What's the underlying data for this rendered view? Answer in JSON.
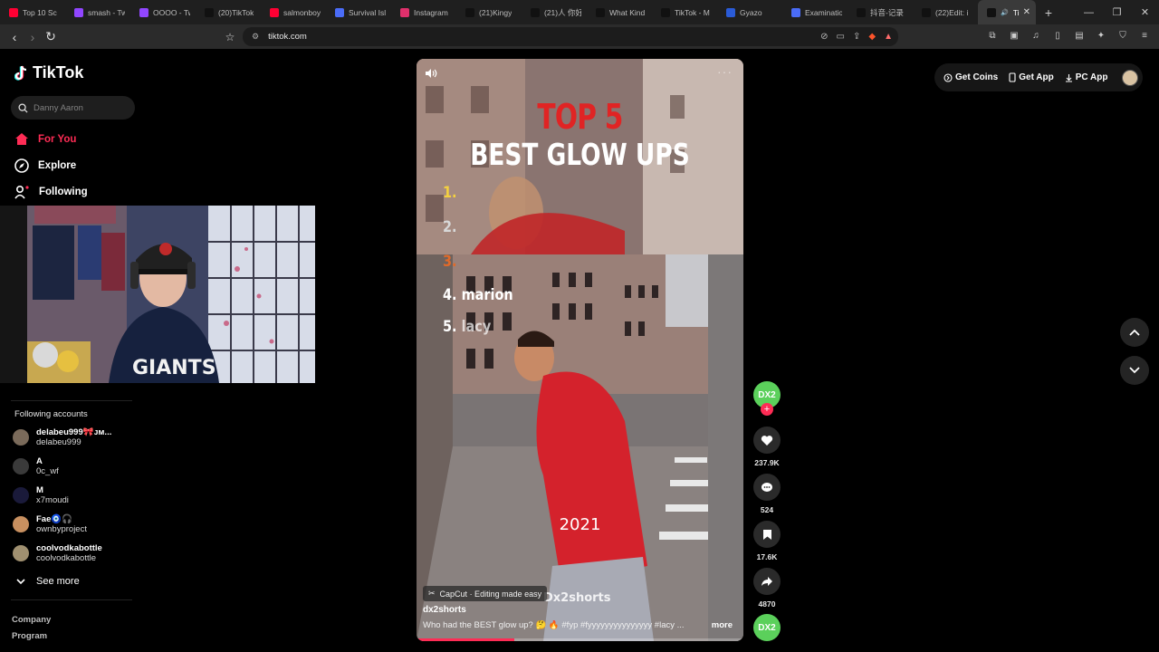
{
  "browser": {
    "tabs": [
      {
        "label": "Top 10 Sc",
        "icon": "youtube-icon",
        "color": "#ff0033"
      },
      {
        "label": "smash - Tw",
        "icon": "twitch-icon",
        "color": "#9146ff"
      },
      {
        "label": "OOOO - Tw",
        "icon": "twitch-icon",
        "color": "#9146ff"
      },
      {
        "label": "(20)TikTok",
        "icon": "tiktok-icon",
        "color": "#111111"
      },
      {
        "label": "salmonboy",
        "icon": "youtube-icon",
        "color": "#ff0033"
      },
      {
        "label": "Survival Isl",
        "icon": "doc-icon",
        "color": "#4a6cf7"
      },
      {
        "label": "Instagram",
        "icon": "instagram-icon",
        "color": "#e1306c"
      },
      {
        "label": "(21)Kingy",
        "icon": "tiktok-icon",
        "color": "#111111"
      },
      {
        "label": "(21)人 你好",
        "icon": "tiktok-icon",
        "color": "#111111"
      },
      {
        "label": "What Kind",
        "icon": "tiktok-icon",
        "color": "#111111"
      },
      {
        "label": "TikTok - M",
        "icon": "tiktok-icon",
        "color": "#111111"
      },
      {
        "label": "Gyazo",
        "icon": "gyazo-icon",
        "color": "#2a5bd7"
      },
      {
        "label": "Examinatio",
        "icon": "doc-icon",
        "color": "#4a6cf7"
      },
      {
        "label": "抖音-记录",
        "icon": "tiktok-icon",
        "color": "#111111"
      },
      {
        "label": "(22)Edit: i",
        "icon": "tiktok-icon",
        "color": "#111111"
      }
    ],
    "active_tab": {
      "label": "Tik",
      "icon": "tiktok-icon"
    },
    "new_tab": "+",
    "url": "tiktok.com"
  },
  "sidebar": {
    "logo": "TikTok",
    "search_placeholder": "Danny Aaron",
    "nav": [
      {
        "label": "For You",
        "icon": "home-icon"
      },
      {
        "label": "Explore",
        "icon": "compass-icon"
      },
      {
        "label": "Following",
        "icon": "following-icon"
      }
    ],
    "following_title": "Following accounts",
    "accounts": [
      {
        "name": "delabeu999🎀ᴊᴍ...",
        "handle": "delabeu999",
        "color": "#7a6a5a"
      },
      {
        "name": "A",
        "handle": "0c_wf",
        "color": "#3a3a3a"
      },
      {
        "name": "M",
        "handle": "x7moudi",
        "color": "#1a1a3a"
      },
      {
        "name": "Fae🧿🎧",
        "handle": "ownbyproject",
        "color": "#c89060"
      },
      {
        "name": "coolvodkabottle",
        "handle": "coolvodkabottle",
        "color": "#a09070"
      }
    ],
    "see_more": "See more",
    "footer": [
      "Company",
      "Program"
    ]
  },
  "video": {
    "title_line1": "TOP 5",
    "title_line2": "BEST GLOW UPS",
    "ranks": [
      {
        "n": "1.",
        "name": ""
      },
      {
        "n": "2.",
        "name": ""
      },
      {
        "n": "3.",
        "name": ""
      },
      {
        "n": "4.",
        "name": "marion"
      },
      {
        "n": "5.",
        "name": "lacy"
      }
    ],
    "year": "2021",
    "watermark": "Dx2shorts",
    "capcut": "CapCut · Editing made easy",
    "author": "dx2shorts",
    "caption": "Who had the BEST glow up? 🤔 🔥 #fyp #fyyyyyyyyyyyyyyy #lacy ...",
    "more": "more",
    "progress": 0.3
  },
  "actions": {
    "profile_label": "DX2",
    "likes": "237.9K",
    "comments": "524",
    "saves": "17.6K",
    "shares": "4870",
    "music_label": "DX2"
  },
  "topright": {
    "get_coins": "Get Coins",
    "get_app": "Get App",
    "pc_app": "PC App"
  }
}
